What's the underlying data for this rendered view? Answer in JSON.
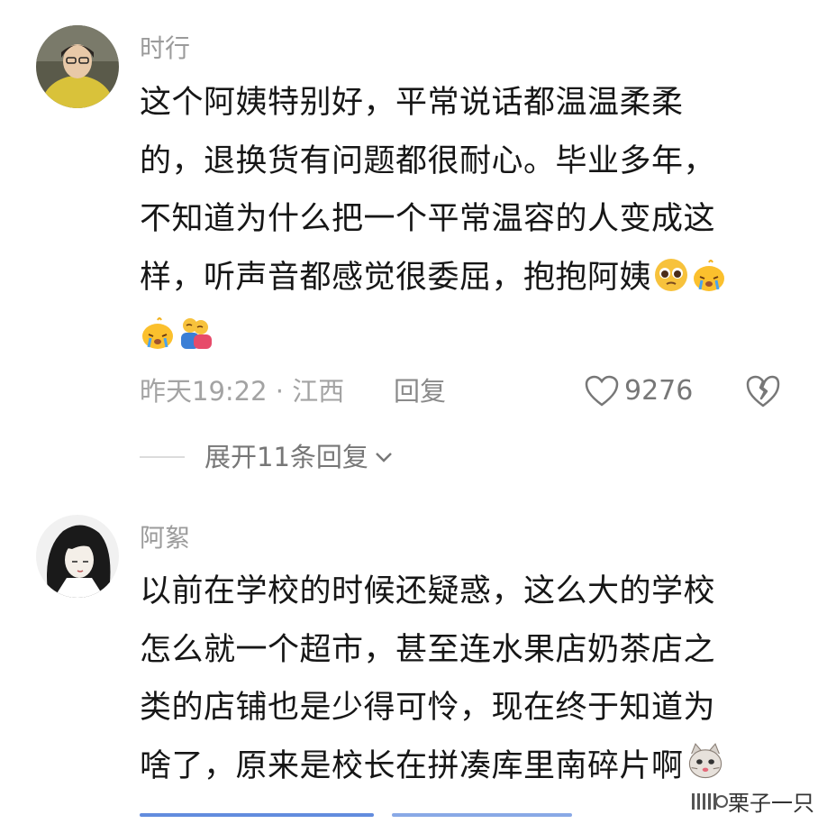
{
  "comments": [
    {
      "username": "时行",
      "lines": [
        "这个阿姨特别好，平常说话都温温柔柔",
        "的，退换货有问题都很耐心。毕业多年，",
        "不知道为什么把一个平常温容的人变成这",
        "样，听声音都感觉很委屈，抱抱阿姨"
      ],
      "emojis": [
        "pleading-face-emoji",
        "crying-chick-emoji",
        "crying-chick-emoji",
        "hugging-people-emoji"
      ],
      "time_location": "昨天19:22 · 江西",
      "reply_label": "回复",
      "like_count": "9276",
      "expand_label": "展开11条回复"
    },
    {
      "username": "阿絮",
      "lines": [
        "以前在学校的时候还疑惑，这么大的学校",
        "怎么就一个超市，甚至连水果店奶茶店之",
        "类的店铺也是少得可怜，现在终于知道为",
        "啥了，原来是校长在拼凑库里南碎片啊"
      ],
      "emojis": [
        "cat-face-emoji"
      ]
    }
  ],
  "watermark": {
    "text": "栗子一只"
  },
  "colors": {
    "text": "#161616",
    "meta": "#a3a3a3",
    "username": "#9b9b9b"
  }
}
